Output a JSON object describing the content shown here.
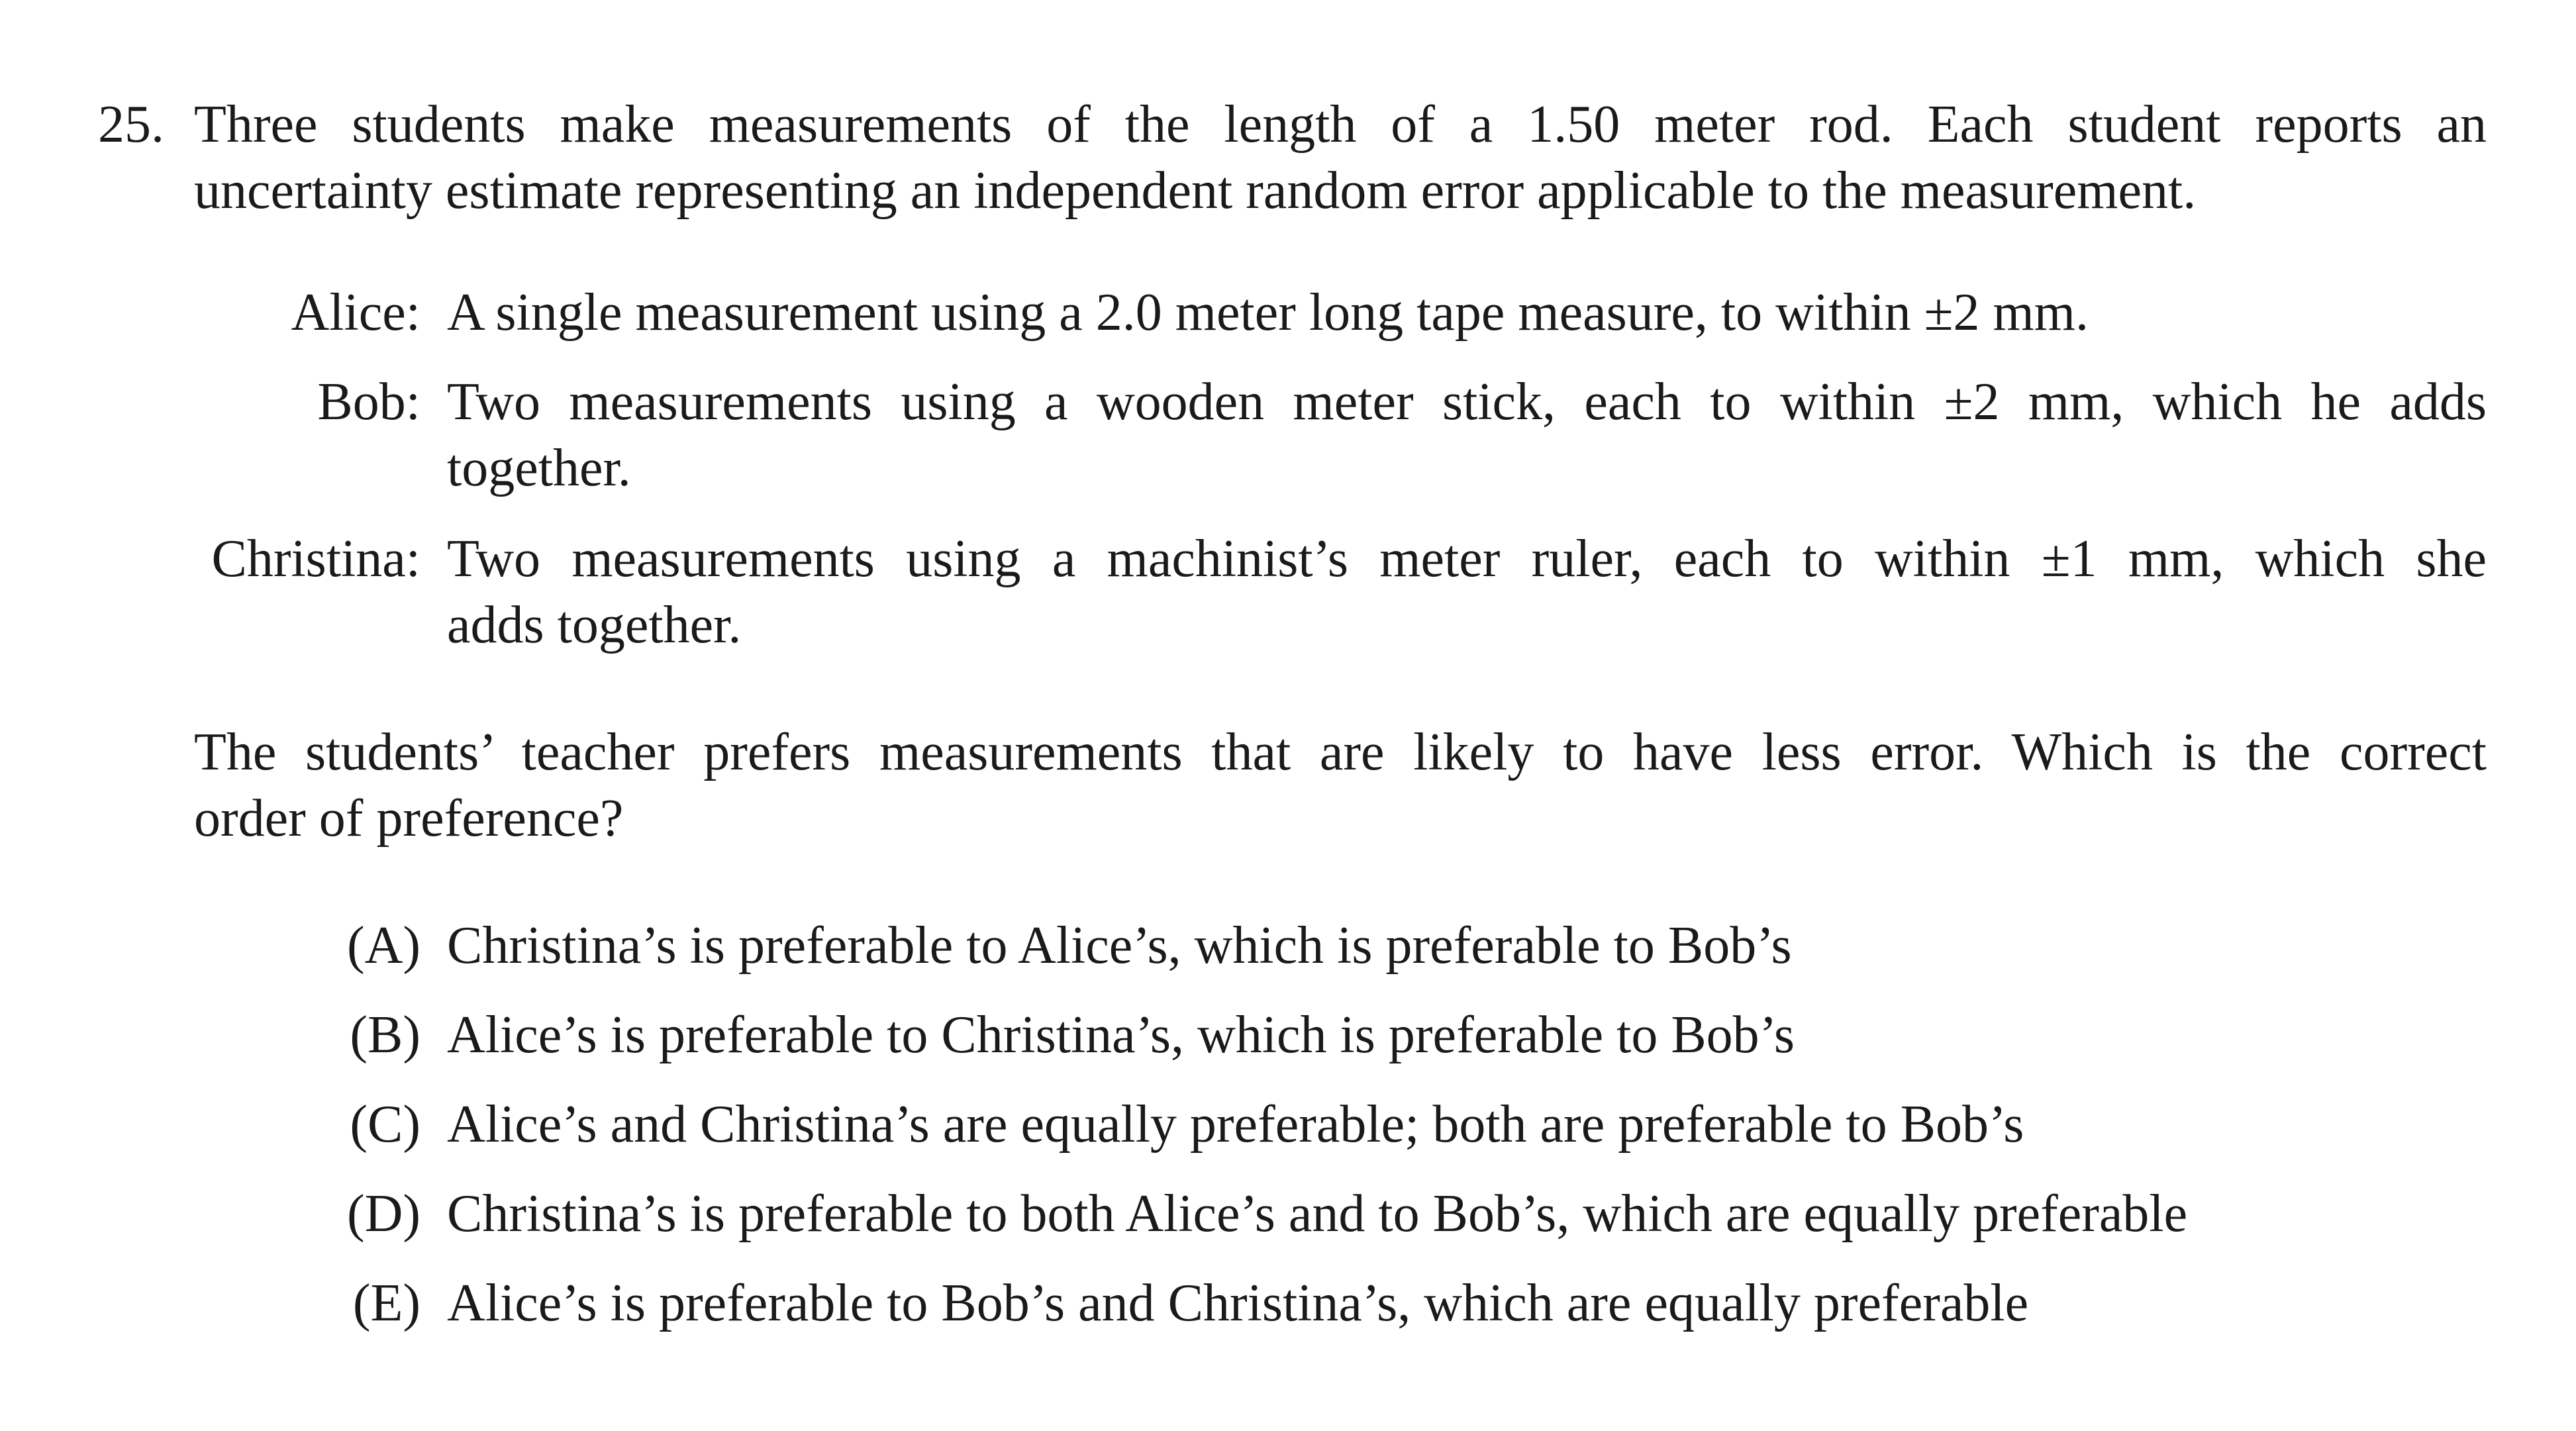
{
  "question": {
    "number": "25.",
    "intro_line_1": "Three students make measurements of the length of a 1.50 meter rod.  Each student reports an",
    "intro_line_2": "uncertainty estimate representing an independent random error applicable to the measurement.",
    "students": [
      {
        "name": "Alice:",
        "line_1": "A single measurement using a 2.0 meter long tape measure, to within ±2 mm.",
        "line_2": ""
      },
      {
        "name": "Bob:",
        "line_1": "Two measurements using a wooden meter stick, each to within ±2 mm, which he adds",
        "line_2": "together."
      },
      {
        "name": "Christina:",
        "line_1": "Two measurements using a machinist’s meter ruler, each to within ±1 mm, which she",
        "line_2": "adds together."
      }
    ],
    "prompt_line_1": "The students’ teacher prefers measurements that are likely to have less error.  Which is the correct",
    "prompt_line_2": "order of preference?",
    "choices": [
      {
        "label": "(A)",
        "text": "Christina’s is preferable to Alice’s, which is preferable to Bob’s"
      },
      {
        "label": "(B)",
        "text": "Alice’s is preferable to Christina’s, which is preferable to Bob’s"
      },
      {
        "label": "(C)",
        "text": "Alice’s and Christina’s are equally preferable; both are preferable to Bob’s"
      },
      {
        "label": "(D)",
        "text": "Christina’s is preferable to both Alice’s and to Bob’s, which are equally preferable"
      },
      {
        "label": "(E)",
        "text": "Alice’s is preferable to Bob’s and Christina’s, which are equally preferable"
      }
    ]
  }
}
